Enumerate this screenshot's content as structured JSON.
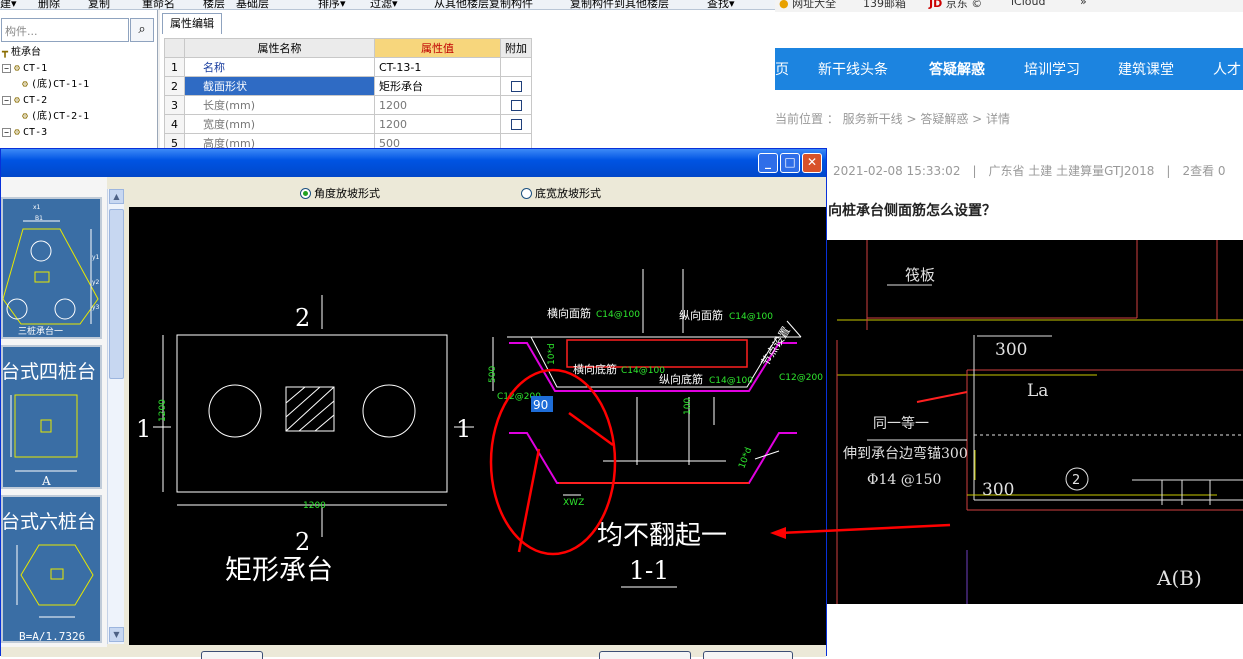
{
  "toolbar": {
    "items": [
      "建▾",
      "删除",
      "复制",
      "重命名",
      "楼层",
      "基础层",
      "排序▾",
      "过滤▾",
      "从其他楼层复制构件",
      "复制构件到其他楼层",
      "查找▾"
    ]
  },
  "tree": {
    "search_placeholder": "构件...",
    "root": "桩承台",
    "items": [
      "CT-1",
      "(底)CT-1-1",
      "CT-2",
      "(底)CT-2-1",
      "CT-3"
    ]
  },
  "props": {
    "tab": "属性编辑",
    "headers": {
      "name": "属性名称",
      "value": "属性值",
      "extra": "附加"
    },
    "rows": [
      {
        "num": "1",
        "name": "名称",
        "value": "CT-13-1"
      },
      {
        "num": "2",
        "name": "截面形状",
        "value": "矩形承台"
      },
      {
        "num": "3",
        "name": "长度(mm)",
        "value": "1200"
      },
      {
        "num": "4",
        "name": "宽度(mm)",
        "value": "1200"
      },
      {
        "num": "5",
        "name": "高度(mm)",
        "value": "500"
      }
    ]
  },
  "dialog": {
    "radio_angle": "角度放坡形式",
    "radio_width": "底宽放坡形式"
  },
  "thumbs": {
    "t1_caption": "三桩承台一",
    "t1_dims": [
      "B1",
      "y1",
      "y2",
      "y3",
      "x1"
    ],
    "t2_caption": "台式四桩台",
    "t2_dim": "A",
    "t3_caption": "台式六桩台",
    "t3_formula": "B=A/1.7326"
  },
  "drawing": {
    "sec_top": "2",
    "sec_bottom": "2",
    "sec_left": "1",
    "sec_right": "1",
    "dim_height": "1200",
    "dim_width": "1200",
    "shape_name": "矩形承台",
    "lbl_h_top": "横向面筋",
    "val_h_top": "C14@100",
    "lbl_v_top": "纵向面筋",
    "val_v_top": "C14@100",
    "lbl_h_bot": "横向底筋",
    "val_h_bot": "C14@100",
    "lbl_v_bot": "纵向底筋",
    "val_v_bot": "C14@100",
    "side_left": "C12@200",
    "side_right": "C12@200",
    "dim_500": "500",
    "dim_10d_a": "10*d",
    "dim_10d_b": "10*d",
    "dim_100": "100",
    "dim_xwz": "XWZ",
    "note_rot": "节点设置",
    "angle": "90",
    "annotation": "均不翻起一",
    "section": "1-1"
  },
  "browser": {
    "bookmarks": [
      "网址大全",
      "139邮箱",
      "京东 ©",
      "iCloud",
      "»"
    ],
    "nav": [
      "页",
      "新干线头条",
      "答疑解惑",
      "培训学习",
      "建筑课堂",
      "人才"
    ],
    "crumb": "当前位置 ： 服务新干线 > 答疑解惑 > 详情",
    "meta": "2021-02-08 15:33:02　|　广东省  土建  土建算量GTJ2018　|　2查看  0",
    "question": "向桩承台侧面筋怎么设置？"
  },
  "right_drawing": {
    "label_top": "筏板",
    "dim_300a": "300",
    "label_la": "La",
    "note1": "同一等一",
    "note2": "伸到承台边弯锚300",
    "note3": "Φ14 @150",
    "dim_300b": "300",
    "circle_num": "2",
    "axis": "A(B)"
  },
  "colors": {
    "accent": "#1c84e0",
    "selected": "#2f6bc4",
    "red": "#ff0000"
  }
}
